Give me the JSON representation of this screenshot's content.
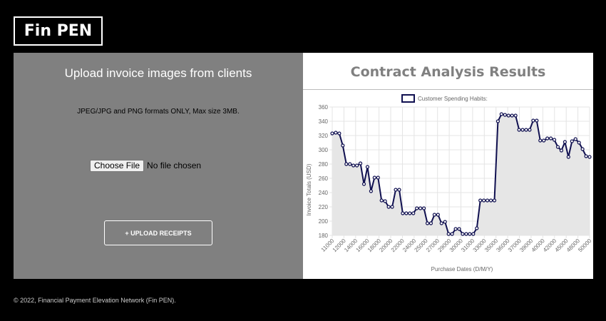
{
  "brand": {
    "name": "Fin PEN"
  },
  "upload": {
    "title": "Upload invoice images from clients",
    "note": "JPEG/JPG and PNG formats ONLY, Max size 3MB.",
    "choose_label": "Choose File",
    "no_file": "No file chosen",
    "button_label": "+ UPLOAD RECEIPTS"
  },
  "results": {
    "title": "Contract Analysis Results"
  },
  "chart_data": {
    "type": "line",
    "title": "",
    "legend": "Customer Spending Habits:",
    "legend_position": "top",
    "xlabel": "Purchase Dates (D/M/Y)",
    "ylabel": "Invoice Totals (USD)",
    "ylim": [
      180,
      360
    ],
    "grid": true,
    "x_tick_labels": [
      "11000",
      "12000",
      "14000",
      "16000",
      "18000",
      "20000",
      "22000",
      "24000",
      "25000",
      "27000",
      "29000",
      "30000",
      "31000",
      "33000",
      "35000",
      "36000",
      "37000",
      "39000",
      "40000",
      "42000",
      "45000",
      "48000",
      "50000"
    ],
    "values": [
      323,
      324,
      323,
      306,
      280,
      280,
      278,
      278,
      281,
      252,
      276,
      242,
      261,
      261,
      229,
      228,
      220,
      220,
      244,
      244,
      211,
      211,
      211,
      211,
      218,
      218,
      218,
      197,
      197,
      209,
      209,
      197,
      199,
      182,
      182,
      189,
      189,
      182,
      182,
      182,
      182,
      190,
      229,
      229,
      229,
      229,
      229,
      340,
      350,
      349,
      348,
      348,
      348,
      328,
      328,
      328,
      328,
      341,
      341,
      313,
      313,
      316,
      316,
      314,
      304,
      299,
      311,
      290,
      312,
      315,
      310,
      301,
      291,
      290
    ],
    "colors": {
      "line": "#101050",
      "fill": "#e6e6e6",
      "grid": "#e4e4e4"
    }
  },
  "footer": {
    "text": "© 2022, Financial Payment Elevation Network (Fin PEN)."
  }
}
